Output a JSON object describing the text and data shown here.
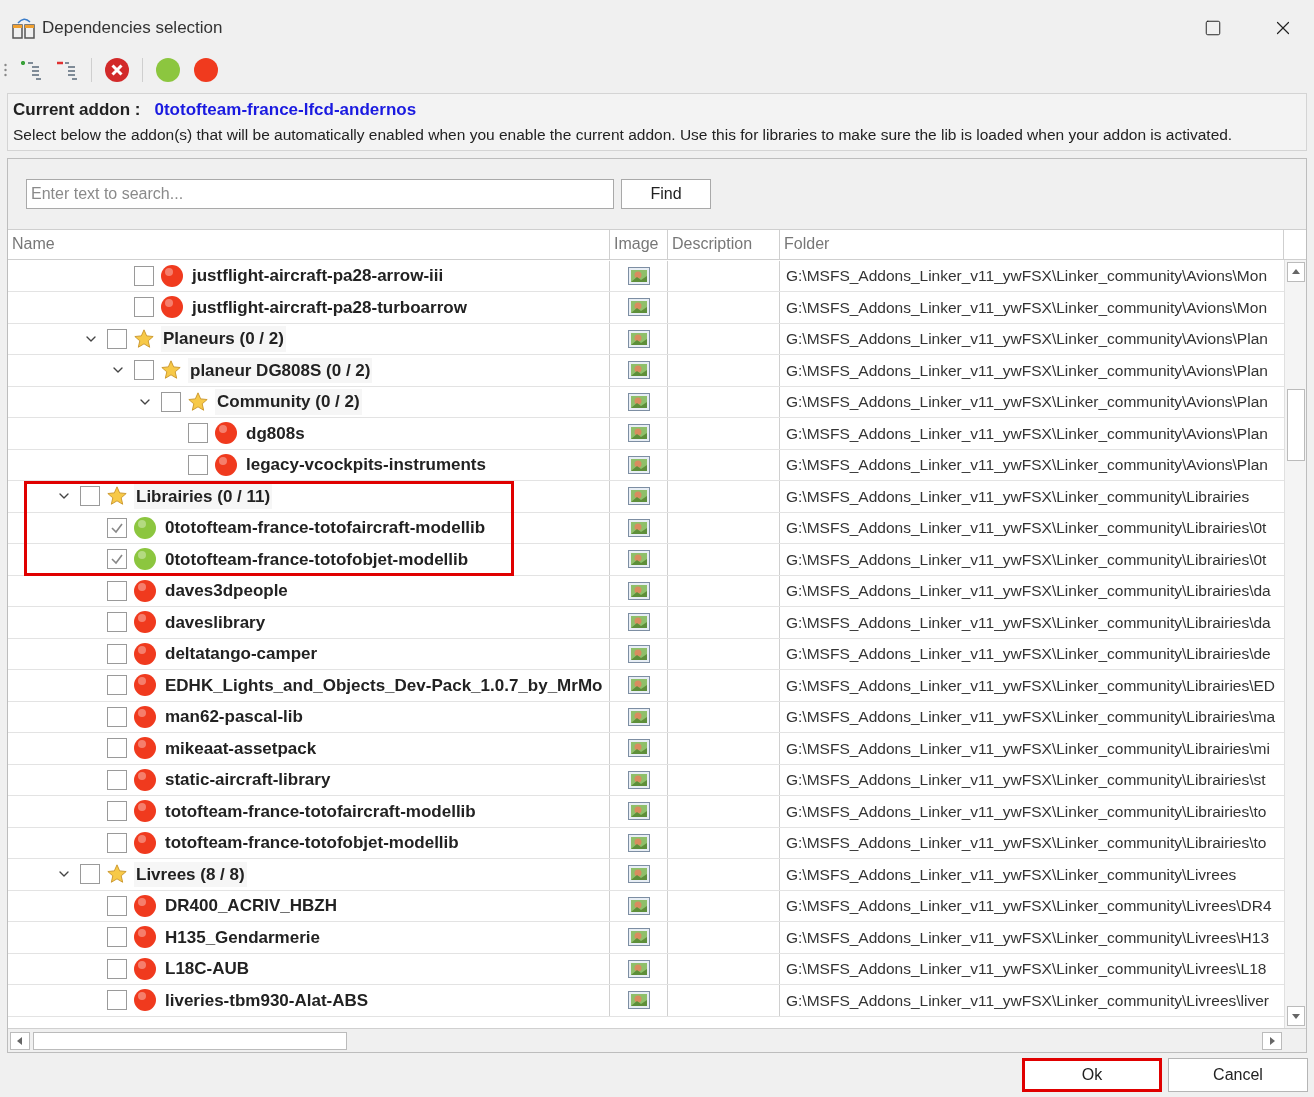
{
  "window": {
    "title": "Dependencies selection"
  },
  "current_addon": {
    "label": "Current addon :",
    "value": "0totofteam-france-lfcd-andernos",
    "description": "Select below the addon(s) that will be automatically enabled when you enable the current addon. Use this for libraries to make sure the lib is loaded when your addon is activated."
  },
  "search": {
    "placeholder": "Enter text to search...",
    "button": "Find"
  },
  "table": {
    "columns": [
      "Name",
      "Image",
      "Description",
      "Folder"
    ],
    "nodes": [
      {
        "children": [
          {
            "children": [
              {
                "label": "justflight-aircraft-pa28-arrow-iii",
                "kind": "addon",
                "enabled": false,
                "checked": false,
                "highlighted": false,
                "folder": "G:\\MSFS_Addons_Linker_v11_ywFSX\\Linker_community\\Avions\\Mon"
              },
              {
                "label": "justflight-aircraft-pa28-turboarrow",
                "kind": "addon",
                "enabled": false,
                "checked": false,
                "highlighted": false,
                "folder": "G:\\MSFS_Addons_Linker_v11_ywFSX\\Linker_community\\Avions\\Mon"
              }
            ]
          },
          {
            "label": "Planeurs (0 / 2)",
            "kind": "group",
            "expanded": true,
            "checked": false,
            "highlighted": false,
            "folder": "G:\\MSFS_Addons_Linker_v11_ywFSX\\Linker_community\\Avions\\Plan",
            "children": [
              {
                "label": "planeur DG808S (0 / 2)",
                "kind": "group",
                "expanded": true,
                "checked": false,
                "highlighted": false,
                "folder": "G:\\MSFS_Addons_Linker_v11_ywFSX\\Linker_community\\Avions\\Plan",
                "children": [
                  {
                    "label": "Community (0 / 2)",
                    "kind": "group",
                    "expanded": true,
                    "checked": false,
                    "highlighted": false,
                    "folder": "G:\\MSFS_Addons_Linker_v11_ywFSX\\Linker_community\\Avions\\Plan",
                    "children": [
                      {
                        "label": "dg808s",
                        "kind": "addon",
                        "enabled": false,
                        "checked": false,
                        "highlighted": false,
                        "folder": "G:\\MSFS_Addons_Linker_v11_ywFSX\\Linker_community\\Avions\\Plan"
                      },
                      {
                        "label": "legacy-vcockpits-instruments",
                        "kind": "addon",
                        "enabled": false,
                        "checked": false,
                        "highlighted": false,
                        "folder": "G:\\MSFS_Addons_Linker_v11_ywFSX\\Linker_community\\Avions\\Plan"
                      }
                    ]
                  }
                ]
              }
            ]
          }
        ]
      },
      {
        "label": "Librairies (0 / 11)",
        "kind": "group",
        "expanded": true,
        "checked": false,
        "highlighted": true,
        "folder": "G:\\MSFS_Addons_Linker_v11_ywFSX\\Linker_community\\Librairies",
        "children": [
          {
            "label": "0totofteam-france-totofaircraft-modellib",
            "kind": "addon",
            "enabled": true,
            "checked": true,
            "highlighted": true,
            "folder": "G:\\MSFS_Addons_Linker_v11_ywFSX\\Linker_community\\Librairies\\0t"
          },
          {
            "label": "0totofteam-france-totofobjet-modellib",
            "kind": "addon",
            "enabled": true,
            "checked": true,
            "highlighted": true,
            "folder": "G:\\MSFS_Addons_Linker_v11_ywFSX\\Linker_community\\Librairies\\0t"
          },
          {
            "label": "daves3dpeople",
            "kind": "addon",
            "enabled": false,
            "checked": false,
            "highlighted": false,
            "folder": "G:\\MSFS_Addons_Linker_v11_ywFSX\\Linker_community\\Librairies\\da"
          },
          {
            "label": "daveslibrary",
            "kind": "addon",
            "enabled": false,
            "checked": false,
            "highlighted": false,
            "folder": "G:\\MSFS_Addons_Linker_v11_ywFSX\\Linker_community\\Librairies\\da"
          },
          {
            "label": "deltatango-camper",
            "kind": "addon",
            "enabled": false,
            "checked": false,
            "highlighted": false,
            "folder": "G:\\MSFS_Addons_Linker_v11_ywFSX\\Linker_community\\Librairies\\de"
          },
          {
            "label": "EDHK_Lights_and_Objects_Dev-Pack_1.0.7_by_MrMo",
            "kind": "addon",
            "enabled": false,
            "checked": false,
            "highlighted": false,
            "folder": "G:\\MSFS_Addons_Linker_v11_ywFSX\\Linker_community\\Librairies\\ED"
          },
          {
            "label": "man62-pascal-lib",
            "kind": "addon",
            "enabled": false,
            "checked": false,
            "highlighted": false,
            "folder": "G:\\MSFS_Addons_Linker_v11_ywFSX\\Linker_community\\Librairies\\ma"
          },
          {
            "label": "mikeaat-assetpack",
            "kind": "addon",
            "enabled": false,
            "checked": false,
            "highlighted": false,
            "folder": "G:\\MSFS_Addons_Linker_v11_ywFSX\\Linker_community\\Librairies\\mi"
          },
          {
            "label": "static-aircraft-library",
            "kind": "addon",
            "enabled": false,
            "checked": false,
            "highlighted": false,
            "folder": "G:\\MSFS_Addons_Linker_v11_ywFSX\\Linker_community\\Librairies\\st"
          },
          {
            "label": "totofteam-france-totofaircraft-modellib",
            "kind": "addon",
            "enabled": false,
            "checked": false,
            "highlighted": false,
            "folder": "G:\\MSFS_Addons_Linker_v11_ywFSX\\Linker_community\\Librairies\\to"
          },
          {
            "label": "totofteam-france-totofobjet-modellib",
            "kind": "addon",
            "enabled": false,
            "checked": false,
            "highlighted": false,
            "folder": "G:\\MSFS_Addons_Linker_v11_ywFSX\\Linker_community\\Librairies\\to"
          }
        ]
      },
      {
        "label": "Livrees (8 / 8)",
        "kind": "group",
        "expanded": true,
        "checked": false,
        "highlighted": false,
        "folder": "G:\\MSFS_Addons_Linker_v11_ywFSX\\Linker_community\\Livrees",
        "children": [
          {
            "label": "DR400_ACRIV_HBZH",
            "kind": "addon",
            "enabled": false,
            "checked": false,
            "highlighted": false,
            "folder": "G:\\MSFS_Addons_Linker_v11_ywFSX\\Linker_community\\Livrees\\DR4"
          },
          {
            "label": "H135_Gendarmerie",
            "kind": "addon",
            "enabled": false,
            "checked": false,
            "highlighted": false,
            "folder": "G:\\MSFS_Addons_Linker_v11_ywFSX\\Linker_community\\Livrees\\H13"
          },
          {
            "label": "L18C-AUB",
            "kind": "addon",
            "enabled": false,
            "checked": false,
            "highlighted": false,
            "folder": "G:\\MSFS_Addons_Linker_v11_ywFSX\\Linker_community\\Livrees\\L18"
          },
          {
            "label": "liveries-tbm930-Alat-ABS",
            "kind": "addon",
            "enabled": false,
            "checked": false,
            "highlighted": false,
            "folder": "G:\\MSFS_Addons_Linker_v11_ywFSX\\Linker_community\\Livrees\\liver"
          }
        ]
      }
    ]
  },
  "buttons": [
    {
      "label": "Ok",
      "highlighted": true
    },
    {
      "label": "Cancel",
      "highlighted": false
    }
  ]
}
